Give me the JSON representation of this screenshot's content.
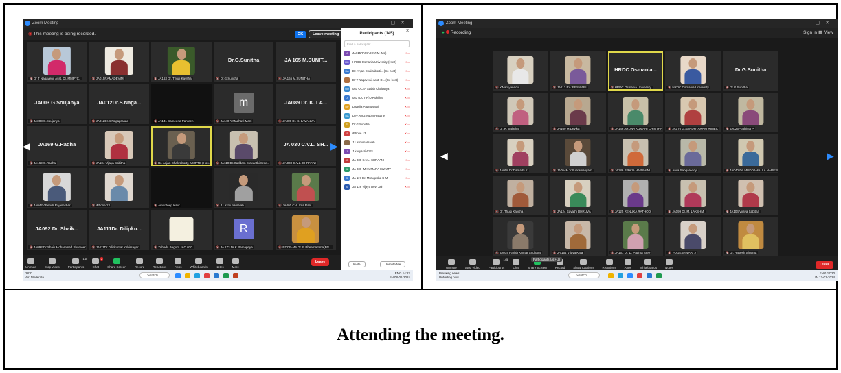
{
  "caption": "Attending the meeting.",
  "left": {
    "window_title": "Zoom Meeting",
    "recording_notice": "This meeting is being recorded.",
    "ok_label": "OK",
    "leave_meeting_label": "Leave meeting",
    "tiles": [
      {
        "big": "",
        "name": "Dr T Nagaveni, Asst. Dr. MMPTC..",
        "kind": "photo",
        "bg": "#b8c8d8",
        "cloth": "#d22a6a"
      },
      {
        "big": "",
        "name": "JA015RAMADEVIM",
        "kind": "photo",
        "bg": "#eeeae0",
        "cloth": "#8a3030"
      },
      {
        "big": "",
        "name": "JA163 Dr. Thudi Kavitha",
        "kind": "photo",
        "bg": "#3a5a2a",
        "cloth": "#e8c030"
      },
      {
        "big": "Dr.G.Sunitha",
        "name": "Dr.G.Sunitha",
        "kind": "text"
      },
      {
        "big": "JA 165 M.SUNIT...",
        "name": "JA 165 M.SUNITHA",
        "kind": "text"
      },
      {
        "big": "JA003 G.Soujanya",
        "name": "JA003 G.Soujanya",
        "kind": "text"
      },
      {
        "big": "JA012Dr.S.Naga...",
        "name": "JA012Dr.S.Nagaprasad",
        "kind": "text"
      },
      {
        "big": "",
        "name": "JA141 Sameena Parveen",
        "kind": "dark"
      },
      {
        "big": "m",
        "name": "JA140 Y.Madhavi Mani",
        "kind": "avatar",
        "color": "#6b6b6b"
      },
      {
        "big": "JA089 Dr. K. LA...",
        "name": "JA089 Dr. K. LAVANYA",
        "kind": "text"
      },
      {
        "big": "JA169 G.Radha",
        "name": "JA169 G.Radha",
        "kind": "text"
      },
      {
        "big": "",
        "name": "JA104 Vijaya Sabitha",
        "kind": "photo",
        "bg": "#d8c8b8",
        "cloth": "#b03040"
      },
      {
        "big": "",
        "name": "Dr. Anjan Chakraborty, MMPTC (Hos..",
        "kind": "photo",
        "bg": "#6a6050",
        "cloth": "#3a3a3a",
        "active": true
      },
      {
        "big": "",
        "name": "JA110 Dr.Gaddam Sravanthi Sree..",
        "kind": "photo",
        "bg": "#c8c0b0",
        "cloth": "#5a4a6a"
      },
      {
        "big": "JA 030 C.V.L. SH...",
        "name": "JA 030 C.V.L. SHRAANI",
        "kind": "text"
      },
      {
        "big": "",
        "name": "JA042V Pendli Rajasekhar",
        "kind": "photo",
        "bg": "#d8d8d8",
        "cloth": "#4a5a7a"
      },
      {
        "big": "",
        "name": "iPhone 13",
        "kind": "photo",
        "bg": "#e0d8d0",
        "cloth": "#6a8aaa"
      },
      {
        "big": "",
        "name": "Amardeep Kaur",
        "kind": "dark"
      },
      {
        "big": "",
        "name": "J Laxmi narsaiah",
        "kind": "photo",
        "bg": "#2a2a2a",
        "cloth": "#a0a0a0"
      },
      {
        "big": "",
        "name": "JA001 CH Uma Rani",
        "kind": "photo",
        "bg": "#5a7a4a",
        "cloth": "#c05050"
      },
      {
        "big": "JA092 Dr. Shaik...",
        "name": "JA092 Dr Shaik Mohammad Shameer",
        "kind": "text"
      },
      {
        "big": "JA111Dr. Dilipku...",
        "name": "JA111Dr Dilipkumar Kshirsagar",
        "kind": "text"
      },
      {
        "big": "",
        "name": "Zubeda Begum JAO 030",
        "kind": "card"
      },
      {
        "big": "R",
        "name": "JA 173 Dr K.Ramapriya",
        "kind": "avatar",
        "color": "#6a6fd0"
      },
      {
        "big": "",
        "name": "RCCE- 45 Dr. B.Bheemamma(PG..",
        "kind": "photo",
        "bg": "#c89040",
        "cloth": "#e0a020"
      }
    ],
    "controls": [
      {
        "label": "Unmute",
        "icon": "mic-icon",
        "green": false
      },
      {
        "label": "Stop Video",
        "icon": "video-icon",
        "green": false
      },
      {
        "label": "Participants",
        "icon": "participants-icon",
        "green": false,
        "badge": "145"
      },
      {
        "label": "Chat",
        "icon": "chat-icon",
        "green": false,
        "badge": "2"
      },
      {
        "label": "Share Screen",
        "icon": "share-icon",
        "green": true
      },
      {
        "label": "Record",
        "icon": "record-icon",
        "green": false
      },
      {
        "label": "Reactions",
        "icon": "reactions-icon",
        "green": false
      },
      {
        "label": "Apps",
        "icon": "apps-icon",
        "green": false
      },
      {
        "label": "Whiteboards",
        "icon": "whiteboard-icon",
        "green": false
      },
      {
        "label": "Notes",
        "icon": "notes-icon",
        "green": false
      },
      {
        "label": "More",
        "icon": "more-icon",
        "green": false
      }
    ],
    "leave_label": "Leave",
    "participants_title": "Participants (145)",
    "find_placeholder": "Find a participant",
    "participants": [
      {
        "initials": "J",
        "name": "JA015RAMADEVI M (Me)",
        "color": "#7a4ab0"
      },
      {
        "initials": "HO",
        "name": "HRDC Osmania University (Host)",
        "color": "#6a5ad0"
      },
      {
        "initials": "DA",
        "name": "Dr. Anjan Chakraborti... (Co-host)",
        "color": "#3a7ad0"
      },
      {
        "initials": "",
        "name": "Dr T Nagaveni, Asst. D... (Co-host)",
        "color": "#b07040"
      },
      {
        "initials": "OO",
        "name": "081 OCTA Satish Chaitanya",
        "color": "#3a8ad0"
      },
      {
        "initials": "O(",
        "name": "083 (OCT-R)D.Rohitha",
        "color": "#3a7ad0"
      },
      {
        "initials": "DP",
        "name": "Daasija Padmavathi",
        "color": "#e0a020"
      },
      {
        "initials": "DA",
        "name": "Dev A092 Nubin Rasane",
        "color": "#3a9ad0"
      },
      {
        "initials": "D",
        "name": "Dr.G.Sunitha",
        "color": "#d0a020"
      },
      {
        "initials": "I1",
        "name": "iPhone 13",
        "color": "#d04040"
      },
      {
        "initials": "",
        "name": "J Laxmi narsaiah",
        "color": "#8a6a4a"
      },
      {
        "initials": "J",
        "name": "J.kavyasri A121",
        "color": "#7a4ab0"
      },
      {
        "initials": "JO",
        "name": "JA 030 C.V.L. SHRAANI",
        "color": "#c03a3a"
      },
      {
        "initials": "JA",
        "name": "JA 036- M KUMARA SWAMY",
        "color": "#2a9a6a"
      },
      {
        "initials": "J1",
        "name": "JA 117 Dr. Murugesha K M",
        "color": "#3a7ad0"
      },
      {
        "initials": "J1",
        "name": "JA 126 Vijaya Devi Jain",
        "color": "#2a5ab0"
      }
    ],
    "invite_label": "Invite",
    "unmute_me_label": "Unmute Me",
    "weather_temp": "28°C",
    "weather_desc": "Air: Moderate",
    "search_label": "Search",
    "lang": "ENG",
    "lang_sub": "IN",
    "time": "14:27",
    "date": "08-01-2024"
  },
  "right": {
    "window_title": "Zoom Meeting",
    "recording_label": "Recording",
    "sign_in": "Sign in",
    "view_label": "View",
    "tiles": [
      {
        "big": "",
        "name": "Y.Narayanadu",
        "kind": "photo",
        "bg": "#d8d0c0",
        "cloth": "#e8e8e8"
      },
      {
        "big": "",
        "name": "JA113 RAJEESWARI",
        "kind": "photo",
        "bg": "#c8b8a0",
        "cloth": "#7a5a9a"
      },
      {
        "big": "HRDC Osmania...",
        "name": "HRDC Osmania University",
        "kind": "text",
        "active": true
      },
      {
        "big": "",
        "name": "HRDC Osmania University",
        "kind": "photo",
        "bg": "#e8d8c8",
        "cloth": "#3a5aa0"
      },
      {
        "big": "Dr.G.Sunitha",
        "name": "Dr.G.Sunitha",
        "kind": "text"
      },
      {
        "big": "",
        "name": "Dr. K. Sujatha",
        "kind": "photo",
        "bg": "#d0c8b8",
        "cloth": "#c06080"
      },
      {
        "big": "",
        "name": "JA169 M.Devika",
        "kind": "photo",
        "bg": "#b8a890",
        "cloth": "#6a3a4a"
      },
      {
        "big": "",
        "name": "JA146 ARUNA KUMARI CHINTHA",
        "kind": "photo",
        "bg": "#c8c0a8",
        "cloth": "#4a8a6a"
      },
      {
        "big": "",
        "name": "JA170 G.SANDHYARANI RIMEC",
        "kind": "photo",
        "bg": "#d8c8b0",
        "cloth": "#b04040"
      },
      {
        "big": "",
        "name": "JA025Prathima P",
        "kind": "photo",
        "bg": "#c0b8a0",
        "cloth": "#8a4a7a"
      },
      {
        "big": "",
        "name": "JA008 Dr.Damathi K",
        "kind": "photo",
        "bg": "#d8d0c0",
        "cloth": "#a04060"
      },
      {
        "big": "",
        "name": "JA054M.V.Subramanyam",
        "kind": "photo",
        "bg": "#5a4a3a",
        "cloth": "#d0d0d0"
      },
      {
        "big": "",
        "name": "JA186 P.RAJA HARSHINI",
        "kind": "photo",
        "bg": "#c8c0b0",
        "cloth": "#d06a3a"
      },
      {
        "big": "",
        "name": "Anila Sangareddy",
        "kind": "photo",
        "bg": "#b8b8a8",
        "cloth": "#6a6a9a"
      },
      {
        "big": "",
        "name": "JA040-Dr. MUDDAMALLA NARESH",
        "kind": "photo",
        "bg": "#d0c8b0",
        "cloth": "#3a6a9a"
      },
      {
        "big": "",
        "name": "Dr. Thudi Kavitha",
        "kind": "photo",
        "bg": "#c0b0a0",
        "cloth": "#a05a3a"
      },
      {
        "big": "",
        "name": "JA124 Savathi DHRUVA",
        "kind": "photo",
        "bg": "#d8d0c0",
        "cloth": "#3a8a5a"
      },
      {
        "big": "",
        "name": "JA125 RENUKA RATHOD",
        "kind": "photo",
        "bg": "#b0b0b0",
        "cloth": "#6a3a8a"
      },
      {
        "big": "",
        "name": "JA099 Dr. M. LAKSHMI",
        "kind": "photo",
        "bg": "#c8c0b0",
        "cloth": "#b03a5a"
      },
      {
        "big": "",
        "name": "JA104 Vijaya Sabitha",
        "kind": "photo",
        "bg": "#d0c0b0",
        "cloth": "#b03a4a"
      },
      {
        "big": "",
        "name": "JA014 Harish Kumar Sridhara",
        "kind": "photo",
        "bg": "#3a3a3a",
        "cloth": "#8a7a6a"
      },
      {
        "big": "",
        "name": "JA 154 Vijaya Kala",
        "kind": "photo",
        "bg": "#c8b8a8",
        "cloth": "#a06a3a"
      },
      {
        "big": "",
        "name": "JA151 Dr. D. Padma Sree",
        "kind": "photo",
        "bg": "#5a7a4a",
        "cloth": "#d0a0b0"
      },
      {
        "big": "",
        "name": "YOGESHWARI J",
        "kind": "photo",
        "bg": "#d8d0c8",
        "cloth": "#4a4a6a"
      },
      {
        "big": "",
        "name": "Dr. Rakesh Sharma",
        "kind": "photo",
        "bg": "#c08a40",
        "cloth": "#e0c060"
      }
    ],
    "controls": [
      {
        "label": "Unmute",
        "icon": "mic-icon",
        "green": false
      },
      {
        "label": "Stop Video",
        "icon": "video-icon",
        "green": false
      },
      {
        "label": "Participants",
        "icon": "participants-icon",
        "green": false,
        "badge": "145"
      },
      {
        "label": "Chat",
        "icon": "chat-icon",
        "green": false
      },
      {
        "label": "Share Screen",
        "icon": "share-icon",
        "green": true
      },
      {
        "label": "Record",
        "icon": "record-icon",
        "green": false
      },
      {
        "label": "Show Captions",
        "icon": "captions-icon",
        "green": false
      },
      {
        "label": "Reactions",
        "icon": "reactions-icon",
        "green": false
      },
      {
        "label": "Apps",
        "icon": "apps-icon",
        "green": false
      },
      {
        "label": "Whiteboards",
        "icon": "whiteboard-icon",
        "green": false
      },
      {
        "label": "Notes",
        "icon": "notes-icon",
        "green": false
      }
    ],
    "tooltip": "Participants (Alt+U)",
    "leave_label": "Leave",
    "news_title": "Breaking news",
    "news_desc": "Unfolding now",
    "search_label": "Search",
    "lang": "ENG",
    "lang_sub": "IN",
    "time": "17:20",
    "date": "12-01-2024"
  }
}
